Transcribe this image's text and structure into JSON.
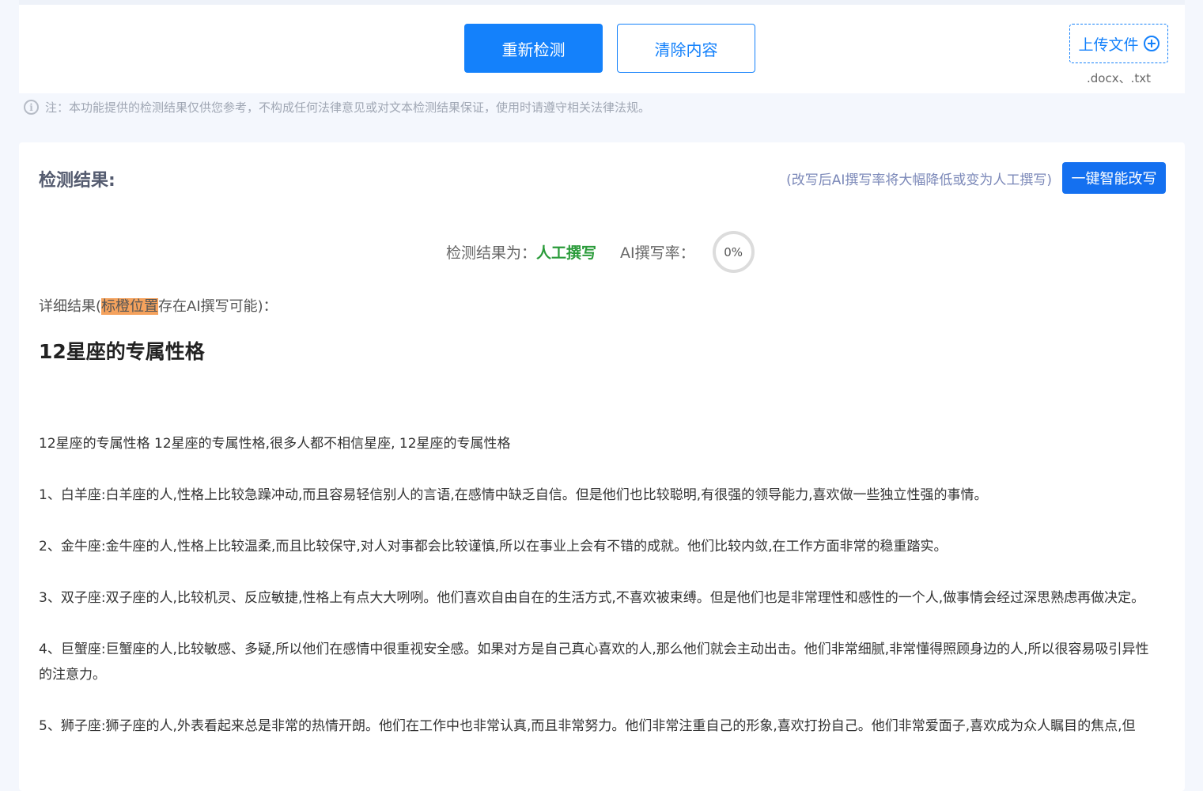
{
  "toolbar": {
    "recheck_label": "重新检测",
    "clear_label": "清除内容",
    "upload_label": "上传文件",
    "upload_hint": ".docx、.txt"
  },
  "note": {
    "text": "注：本功能提供的检测结果仅供您参考，不构成任何法律意见或对文本检测结果保证，使用时请遵守相关法律法规。"
  },
  "result": {
    "title": "检测结果:",
    "rewrite_tip": "(改写后AI撰写率将大幅降低或变为人工撰写)",
    "rewrite_button": "一键智能改写",
    "verdict_label": "检测结果为：",
    "verdict_value": "人工撰写",
    "rate_label": "AI撰写率：",
    "rate_value": "0%",
    "detail_prefix": "详细结果(",
    "detail_highlight": "标橙位置",
    "detail_suffix": "存在AI撰写可能)："
  },
  "article": {
    "title": "12星座的专属性格",
    "paragraphs": [
      "12星座的专属性格 12星座的专属性格,很多人都不相信星座, 12星座的专属性格",
      "1、白羊座:白羊座的人,性格上比较急躁冲动,而且容易轻信别人的言语,在感情中缺乏自信。但是他们也比较聪明,有很强的领导能力,喜欢做一些独立性强的事情。",
      "2、金牛座:金牛座的人,性格上比较温柔,而且比较保守,对人对事都会比较谨慎,所以在事业上会有不错的成就。他们比较内敛,在工作方面非常的稳重踏实。",
      "3、双子座:双子座的人,比较机灵、反应敏捷,性格上有点大大咧咧。他们喜欢自由自在的生活方式,不喜欢被束缚。但是他们也是非常理性和感性的一个人,做事情会经过深思熟虑再做决定。",
      "4、巨蟹座:巨蟹座的人,比较敏感、多疑,所以他们在感情中很重视安全感。如果对方是自己真心喜欢的人,那么他们就会主动出击。他们非常细腻,非常懂得照顾身边的人,所以很容易吸引异性的注意力。",
      "5、狮子座:狮子座的人,外表看起来总是非常的热情开朗。他们在工作中也非常认真,而且非常努力。他们非常注重自己的形象,喜欢打扮自己。他们非常爱面子,喜欢成为众人瞩目的焦点,但"
    ]
  }
}
